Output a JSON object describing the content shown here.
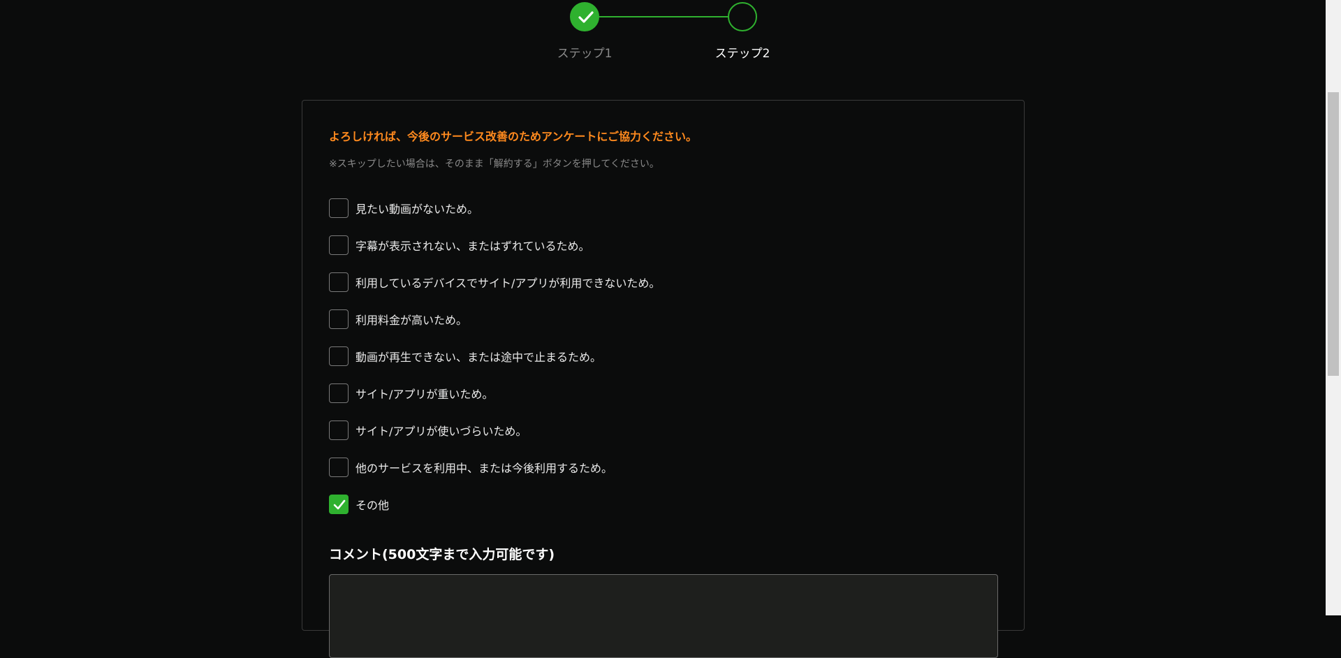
{
  "stepper": {
    "steps": [
      {
        "label": "ステップ1",
        "status": "complete"
      },
      {
        "label": "ステップ2",
        "status": "current"
      }
    ],
    "accent_color": "#2fb12f"
  },
  "survey": {
    "heading": "よろしければ、今後のサービス改善のためアンケートにご協力ください。",
    "heading_color": "#ff8a1e",
    "note": "※スキップしたい場合は、そのまま「解約する」ボタンを押してください。",
    "options": [
      {
        "label": "見たい動画がないため。",
        "checked": false
      },
      {
        "label": "字幕が表示されない、またはずれているため。",
        "checked": false
      },
      {
        "label": "利用しているデバイスでサイト/アプリが利用できないため。",
        "checked": false
      },
      {
        "label": "利用料金が高いため。",
        "checked": false
      },
      {
        "label": "動画が再生できない、または途中で止まるため。",
        "checked": false
      },
      {
        "label": "サイト/アプリが重いため。",
        "checked": false
      },
      {
        "label": "サイト/アプリが使いづらいため。",
        "checked": false
      },
      {
        "label": "他のサービスを利用中、または今後利用するため。",
        "checked": false
      },
      {
        "label": "その他",
        "checked": true
      }
    ],
    "comment": {
      "title": "コメント(500文字まで入力可能です)",
      "value": ""
    }
  }
}
